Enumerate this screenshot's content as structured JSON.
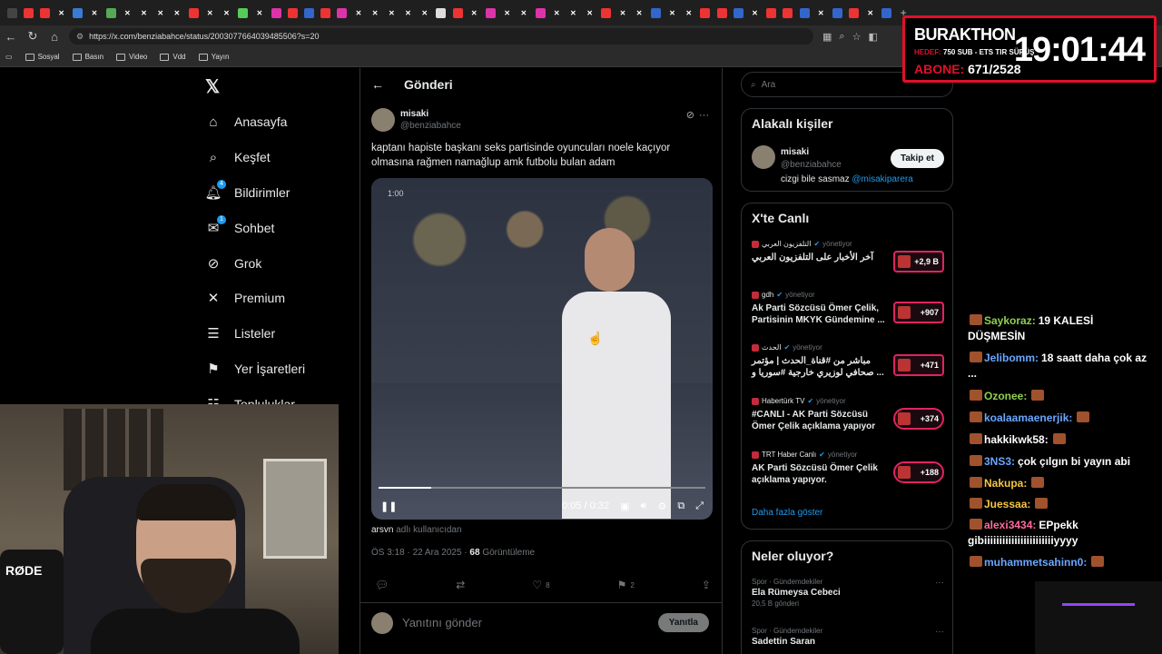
{
  "browser": {
    "url": "https://x.com/benziabahce/status/2003077664039485506?s=20",
    "bookmarks": [
      "Sosyal",
      "Basın",
      "Video",
      "Vdd",
      "Yayın"
    ]
  },
  "nav": {
    "items": [
      {
        "label": "Anasayfa",
        "icon": "home-icon"
      },
      {
        "label": "Keşfet",
        "icon": "search-icon"
      },
      {
        "label": "Bildirimler",
        "icon": "bell-icon",
        "badge": "4"
      },
      {
        "label": "Sohbet",
        "icon": "mail-icon",
        "badge": "1"
      },
      {
        "label": "Grok",
        "icon": "grok-icon"
      },
      {
        "label": "Premium",
        "icon": "x-icon"
      },
      {
        "label": "Listeler",
        "icon": "list-icon"
      },
      {
        "label": "Yer İşaretleri",
        "icon": "bookmark-icon"
      },
      {
        "label": "Topluluklar",
        "icon": "community-icon"
      }
    ]
  },
  "post": {
    "header": "Gönderi",
    "name": "misaki",
    "handle": "@benziabahce",
    "text": "kaptanı hapiste başkanı seks partisinde oyuncuları noele kaçıyor olmasına rağmen namağlup amk futbolu bulan adam",
    "video_start": "1:00",
    "video_time": "0:05 / 0:32",
    "video_progress": 0.16,
    "sound_user": "arsvn",
    "sound_suffix": "adlı kullanıcıdan",
    "date": "ÖS 3:18 · 22 Ara 2025 ·",
    "views": "68",
    "views_label": "Görüntüleme",
    "likes": "8",
    "bookmarks": "2",
    "reply_placeholder": "Yanıtını gönder",
    "reply_button": "Yanıtla"
  },
  "sidebar": {
    "search_placeholder": "Ara",
    "related_title": "Alakalı kişiler",
    "related": {
      "name": "misaki",
      "handle": "@benziabahce",
      "bio": "cizgi bile sasmaz",
      "bio_link": "@misakiparera",
      "follow": "Takip et"
    },
    "live_title": "X'te Canlı",
    "live": [
      {
        "source": "التلفزيون العربي",
        "status": "yönetiyor",
        "title": "آخر الأخبار على التلفزيون العربي",
        "count": "+2,9 B"
      },
      {
        "source": "gdh",
        "status": "yönetiyor",
        "title": "Ak Parti Sözcüsü Ömer Çelik, Partisinin MKYK Gündemine ...",
        "count": "+907"
      },
      {
        "source": "الحدث",
        "status": "yönetiyor",
        "title": "مباشر من #قناة_الحدث | مؤتمر صحافي لوزيري خارجية #سوريا و ...",
        "count": "+471"
      },
      {
        "source": "Habertürk TV",
        "status": "yönetiyor",
        "title": "#CANLI - AK Parti Sözcüsü Ömer Çelik açıklama yapıyor",
        "count": "+374"
      },
      {
        "source": "TRT Haber Canlı",
        "status": "yönetiyor",
        "title": "AK Parti Sözcüsü Ömer Çelik açıklama yapıyor.",
        "count": "+188"
      }
    ],
    "show_more": "Daha fazla göster",
    "happening_title": "Neler oluyor?",
    "trends": [
      {
        "category": "Spor · Gündemdekiler",
        "title": "Ela Rümeysa Cebeci",
        "posts": "20,5 B gönderi"
      },
      {
        "category": "Spor · Gündemdekiler",
        "title": "Sadettin Saran",
        "posts": ""
      }
    ]
  },
  "stream": {
    "name": "BURAKTHON",
    "goal_label": "HEDEF:",
    "goal_text": "750 SUB - ETS TIR SÜRÜŞ",
    "sub_label": "ABONE:",
    "sub_count": "671/2528",
    "clock": "19:01:44"
  },
  "chat": [
    {
      "user": "Saykoraz:",
      "text": "19 KALESİ DÜŞMESİN",
      "color": "#8fd14f"
    },
    {
      "user": "Jelibomm:",
      "text": "18 saatt daha çok az ...",
      "color": "#6aa6ff"
    },
    {
      "user": "Ozonee:",
      "text": "",
      "color": "#8fd14f"
    },
    {
      "user": "koalaamaenerjik:",
      "text": "",
      "color": "#6aa6ff"
    },
    {
      "user": "hakkikwk58:",
      "text": "",
      "color": "#ffffff"
    },
    {
      "user": "3NS3:",
      "text": "çok çılgın bi yayın abi",
      "color": "#6aa6ff"
    },
    {
      "user": "Nakupa:",
      "text": "",
      "color": "#f5c542"
    },
    {
      "user": "Juessaa:",
      "text": "",
      "color": "#f5c542"
    },
    {
      "user": "alexi3434:",
      "text": "EPpekk gibiiiiiiiiiiiiiiiiiiiiiiiyyyy",
      "color": "#ff6b9a"
    },
    {
      "user": "muhammetsahinn0:",
      "text": "",
      "color": "#6aa6ff"
    }
  ],
  "webcam": {
    "mic_brand": "RØDE"
  }
}
